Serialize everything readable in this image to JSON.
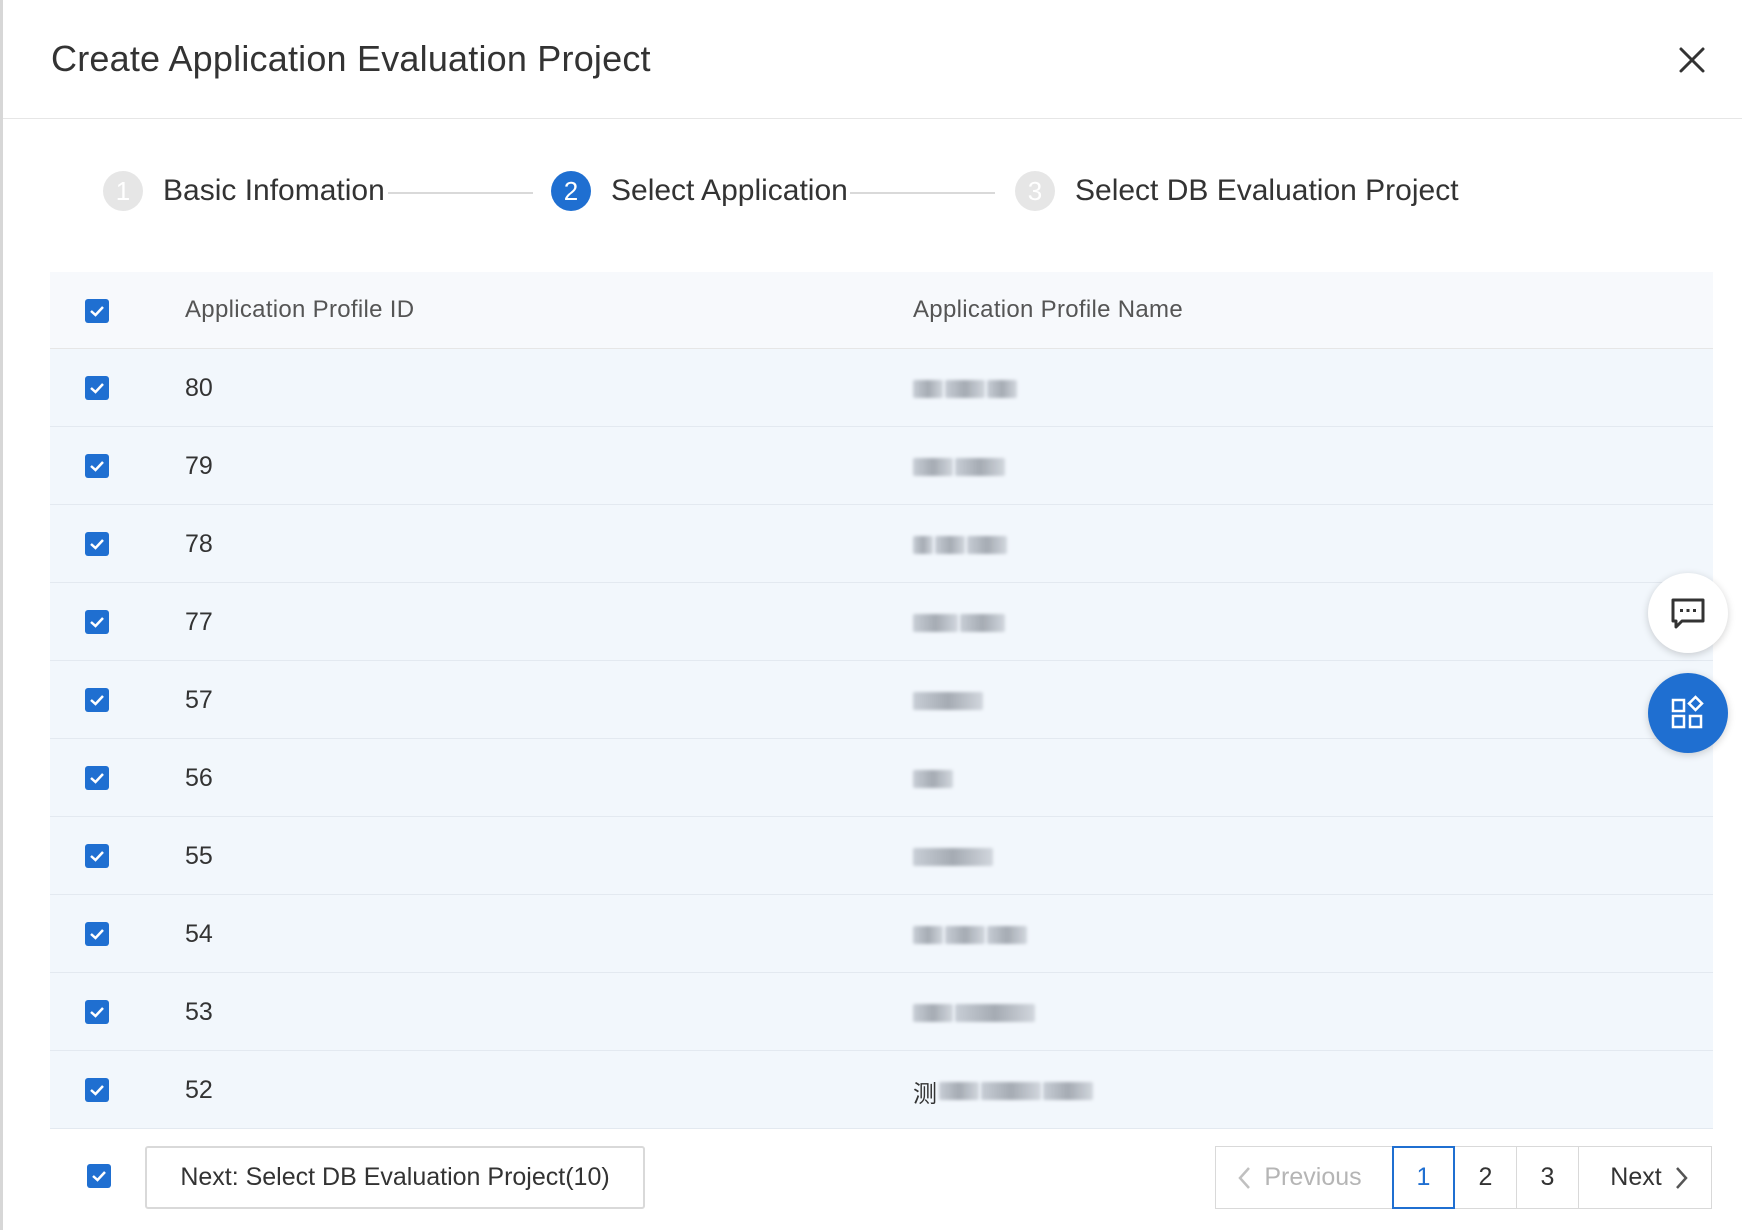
{
  "dialog": {
    "title": "Create Application Evaluation Project"
  },
  "steps": [
    {
      "number": "1",
      "label": "Basic Infomation",
      "state": "done"
    },
    {
      "number": "2",
      "label": "Select Application",
      "state": "active"
    },
    {
      "number": "3",
      "label": "Select DB Evaluation Project",
      "state": "pending"
    }
  ],
  "table": {
    "columns": {
      "id": "Application Profile ID",
      "name": "Application Profile Name"
    },
    "rows": [
      {
        "id": "80",
        "name": "",
        "checked": true
      },
      {
        "id": "79",
        "name": "",
        "checked": true
      },
      {
        "id": "78",
        "name": "",
        "checked": true
      },
      {
        "id": "77",
        "name": "",
        "checked": true
      },
      {
        "id": "57",
        "name": "",
        "checked": true
      },
      {
        "id": "56",
        "name": "",
        "checked": true
      },
      {
        "id": "55",
        "name": "",
        "checked": true
      },
      {
        "id": "54",
        "name": "",
        "checked": true
      },
      {
        "id": "53",
        "name": "",
        "checked": true
      },
      {
        "id": "52",
        "name": "测",
        "checked": true
      }
    ]
  },
  "footer": {
    "next_button": "Next: Select DB Evaluation Project(10)",
    "pagination": {
      "previous": "Previous",
      "pages": [
        "1",
        "2",
        "3"
      ],
      "current": "1",
      "next": "Next"
    }
  },
  "colors": {
    "accent": "#1f6fd1",
    "row_bg": "#f2f7fc",
    "header_bg": "#f7f9fc"
  },
  "icons": {
    "close": "close-icon",
    "checkbox": "checkmark-icon",
    "prev": "chevron-left-icon",
    "next": "chevron-right-icon",
    "chat": "chat-bubble-icon",
    "apps": "apps-grid-icon"
  }
}
